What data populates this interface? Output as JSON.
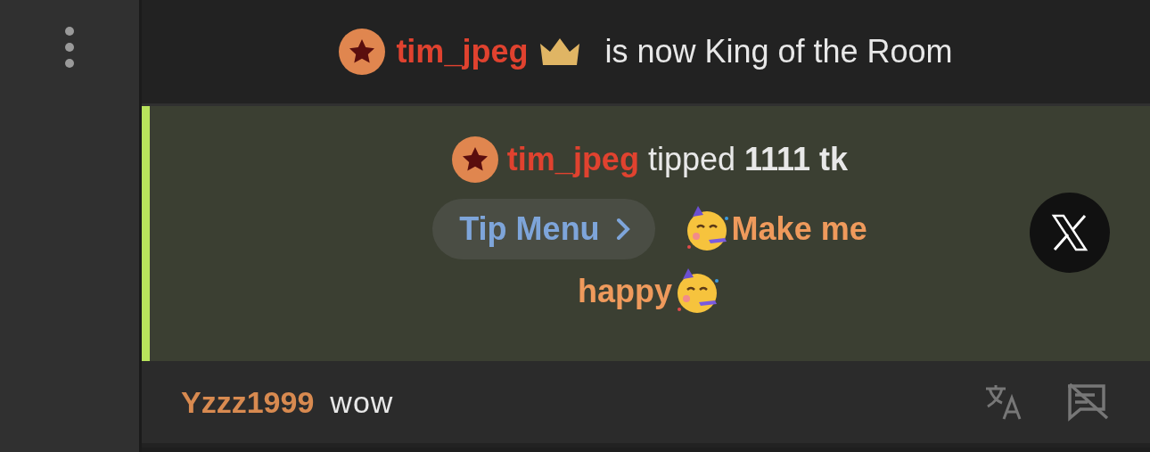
{
  "king_notice": {
    "username": "tim_jpeg",
    "text": "is now King of the Room"
  },
  "tip": {
    "username": "tim_jpeg",
    "action": "tipped",
    "amount": "1111 tk",
    "menu_button": "Tip Menu",
    "message_line_1": "Make me",
    "message_line_2": "happy"
  },
  "chat": [
    {
      "username": "Yzzz1999",
      "text": "wow"
    }
  ]
}
